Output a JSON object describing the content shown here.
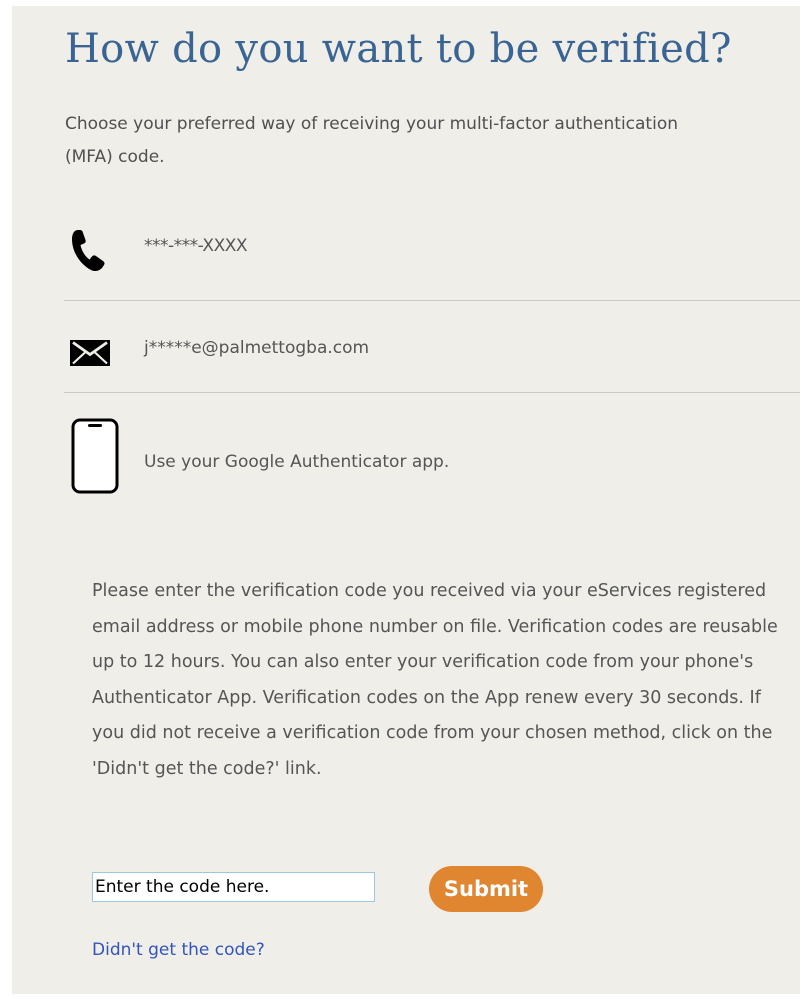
{
  "header": {
    "title": "How do you want to be verified?",
    "intro": "Choose your preferred way of receiving your multi-factor authentication (MFA) code."
  },
  "methods": [
    {
      "icon": "phone-icon",
      "label": "***-***-XXXX"
    },
    {
      "icon": "envelope-icon",
      "label": "j*****e@palmettogba.com"
    },
    {
      "icon": "smartphone-icon",
      "label": "Use your Google Authenticator app."
    }
  ],
  "instructions": "Please enter the verification code you received via your eServices registered email address or mobile phone number on file. Verification codes are reusable up to 12 hours. You can also enter your verification code from your phone's Authenticator App. Verification codes on the App renew every 30 seconds. If you did not receive a verification code from your chosen method, click on the 'Didn't get the code?' link.",
  "form": {
    "code_placeholder": "Enter the code here.",
    "code_value": "",
    "submit_label": "Submit",
    "resend_link": "Didn't get the code?"
  },
  "colors": {
    "title": "#3a6493",
    "panel_background": "#efeee9",
    "submit_button": "#e08530",
    "link": "#3355bb"
  }
}
